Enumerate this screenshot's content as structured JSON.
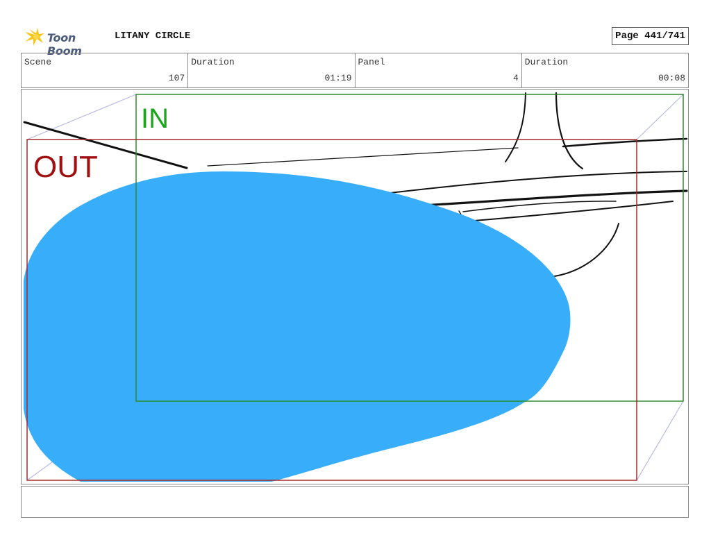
{
  "header": {
    "logo_text": "Toon Boom",
    "project_title": "LITANY CIRCLE",
    "page_label": "Page 441/741"
  },
  "info": [
    {
      "label": "Scene",
      "value": "107"
    },
    {
      "label": "Duration",
      "value": "01:19"
    },
    {
      "label": "Panel",
      "value": "4"
    },
    {
      "label": "Duration",
      "value": "00:08"
    }
  ],
  "panel": {
    "in_label": "IN",
    "out_label": "OUT",
    "colors": {
      "blob": "#38aefa",
      "in_frame": "#2e8b2e",
      "in_text": "#1aa61a",
      "out_frame": "#a52a2a",
      "out_text": "#a01010",
      "camera_guides": "#b8b8e6",
      "sketch": "#111111"
    }
  },
  "notes": {
    "text": ""
  }
}
